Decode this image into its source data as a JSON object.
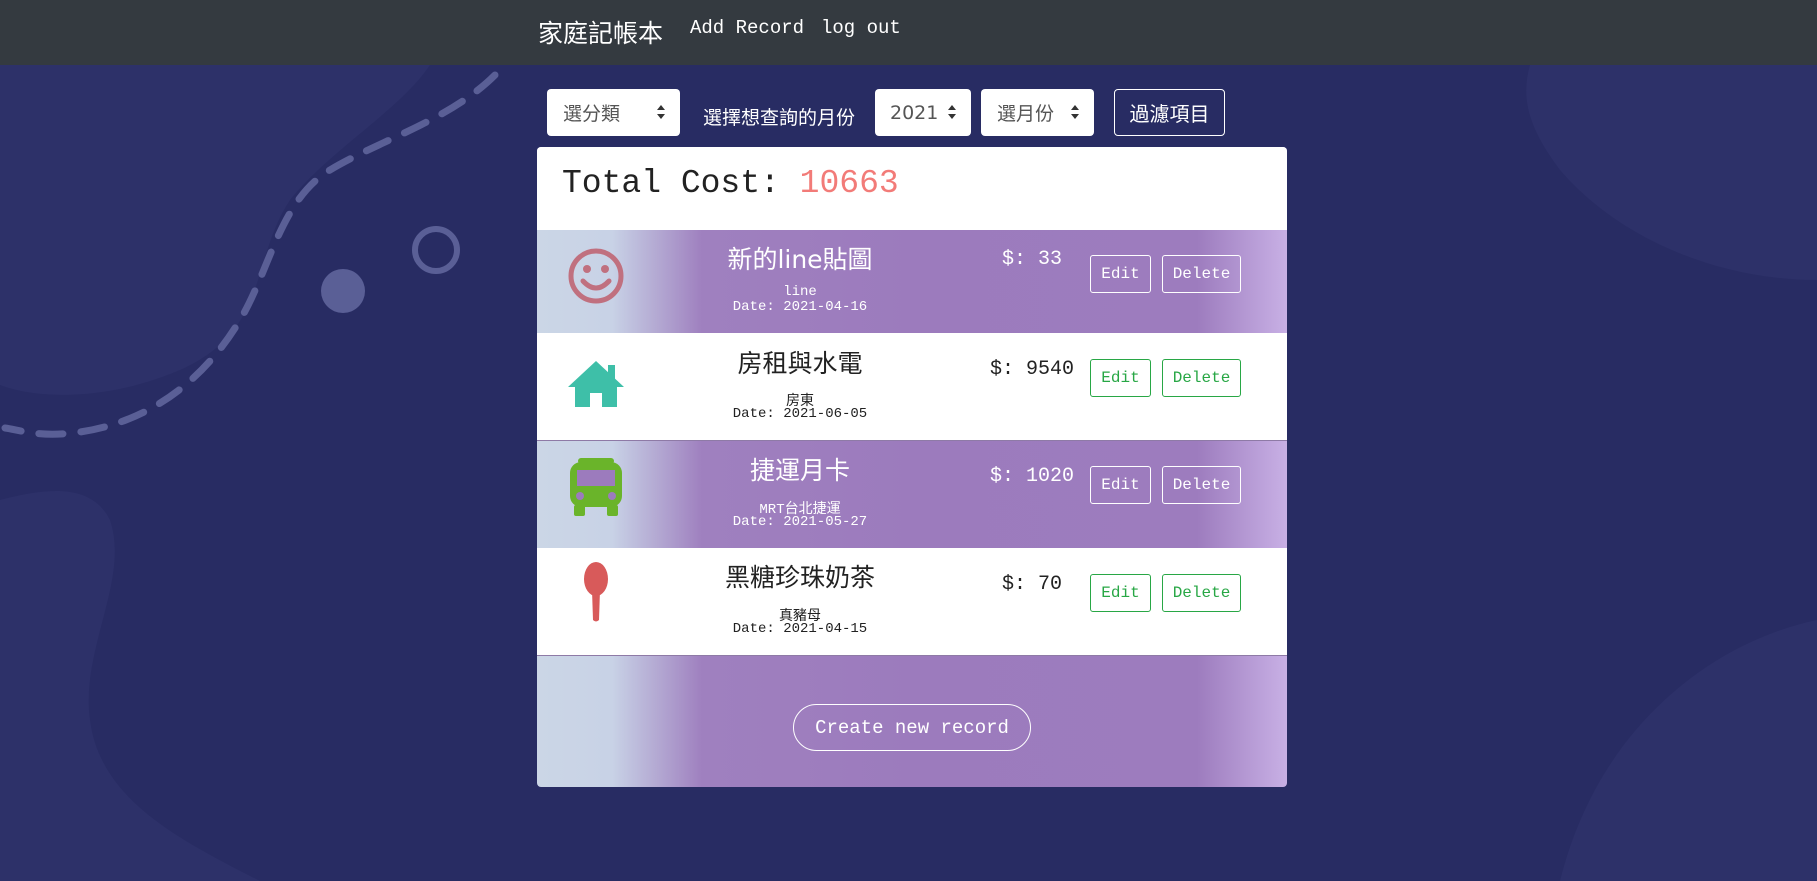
{
  "navbar": {
    "brand": "家庭記帳本",
    "links": [
      "Add Record",
      "log out"
    ]
  },
  "filters": {
    "category_select": "選分類",
    "month_prompt": "選擇想查詢的月份",
    "year_select": "2021",
    "month_select": "選月份",
    "filter_button": "過濾項目"
  },
  "summary": {
    "label": "Total Cost:",
    "value": "10663"
  },
  "records": [
    {
      "name": "新的line貼圖",
      "merchant": "line",
      "date": "Date: 2021-04-16",
      "amount": "$: 33",
      "icon": "smile-icon",
      "icon_color": "#c0707f",
      "theme": "purple"
    },
    {
      "name": "房租與水電",
      "merchant": "房東",
      "date": "Date: 2021-06-05",
      "amount": "$: 9540",
      "icon": "home-icon",
      "icon_color": "#3ebfa8",
      "theme": "white"
    },
    {
      "name": "捷運月卡",
      "merchant": "MRT台北捷運",
      "date": "Date: 2021-05-27",
      "amount": "$: 1020",
      "icon": "bus-icon",
      "icon_color": "#6ab42a",
      "theme": "purple"
    },
    {
      "name": "黑糖珍珠奶茶",
      "merchant": "真豬母",
      "date": "Date: 2021-04-15",
      "amount": "$: 70",
      "icon": "spoon-icon",
      "icon_color": "#d85a5a",
      "theme": "white"
    }
  ],
  "actions": {
    "edit_label": "Edit",
    "delete_label": "Delete",
    "create_label": "Create new record"
  },
  "colors": {
    "background": "#282c63",
    "navbar": "#343a40",
    "total_value": "#f27b78",
    "success_green": "#28a745"
  }
}
